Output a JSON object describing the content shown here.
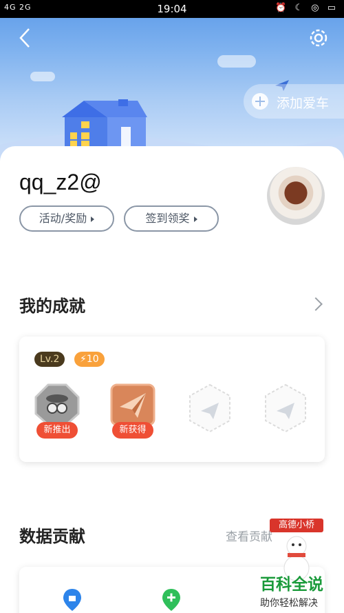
{
  "status_bar": {
    "signal_left": "4G 2G",
    "time": "19:04",
    "icons_right": "⏰ ☾ ◎ ▭"
  },
  "header": {
    "add_car_label": "添加爱车"
  },
  "profile": {
    "username": "qq_z2@",
    "activity_button": "活动/奖励",
    "checkin_button": "签到领奖"
  },
  "achievements": {
    "title": "我的成就",
    "level": "Lv.2",
    "points": "10",
    "badges": [
      {
        "tag": "新推出",
        "icon": "spy-badge-icon"
      },
      {
        "tag": "新获得",
        "icon": "paper-plane-badge-icon"
      },
      {
        "tag": "",
        "icon": "locked-badge-icon"
      },
      {
        "tag": "",
        "icon": "locked-badge-icon"
      }
    ]
  },
  "contribution": {
    "title": "数据贡献",
    "link": "查看贡献"
  },
  "promo": {
    "banner_text": "高德小桥"
  },
  "watermark": {
    "title": "百科全说",
    "subtitle": "助你轻松解决"
  },
  "colors": {
    "accent_orange": "#f9a13b",
    "badge_red": "#ef4f35",
    "sky_blue": "#5b9ae8"
  }
}
